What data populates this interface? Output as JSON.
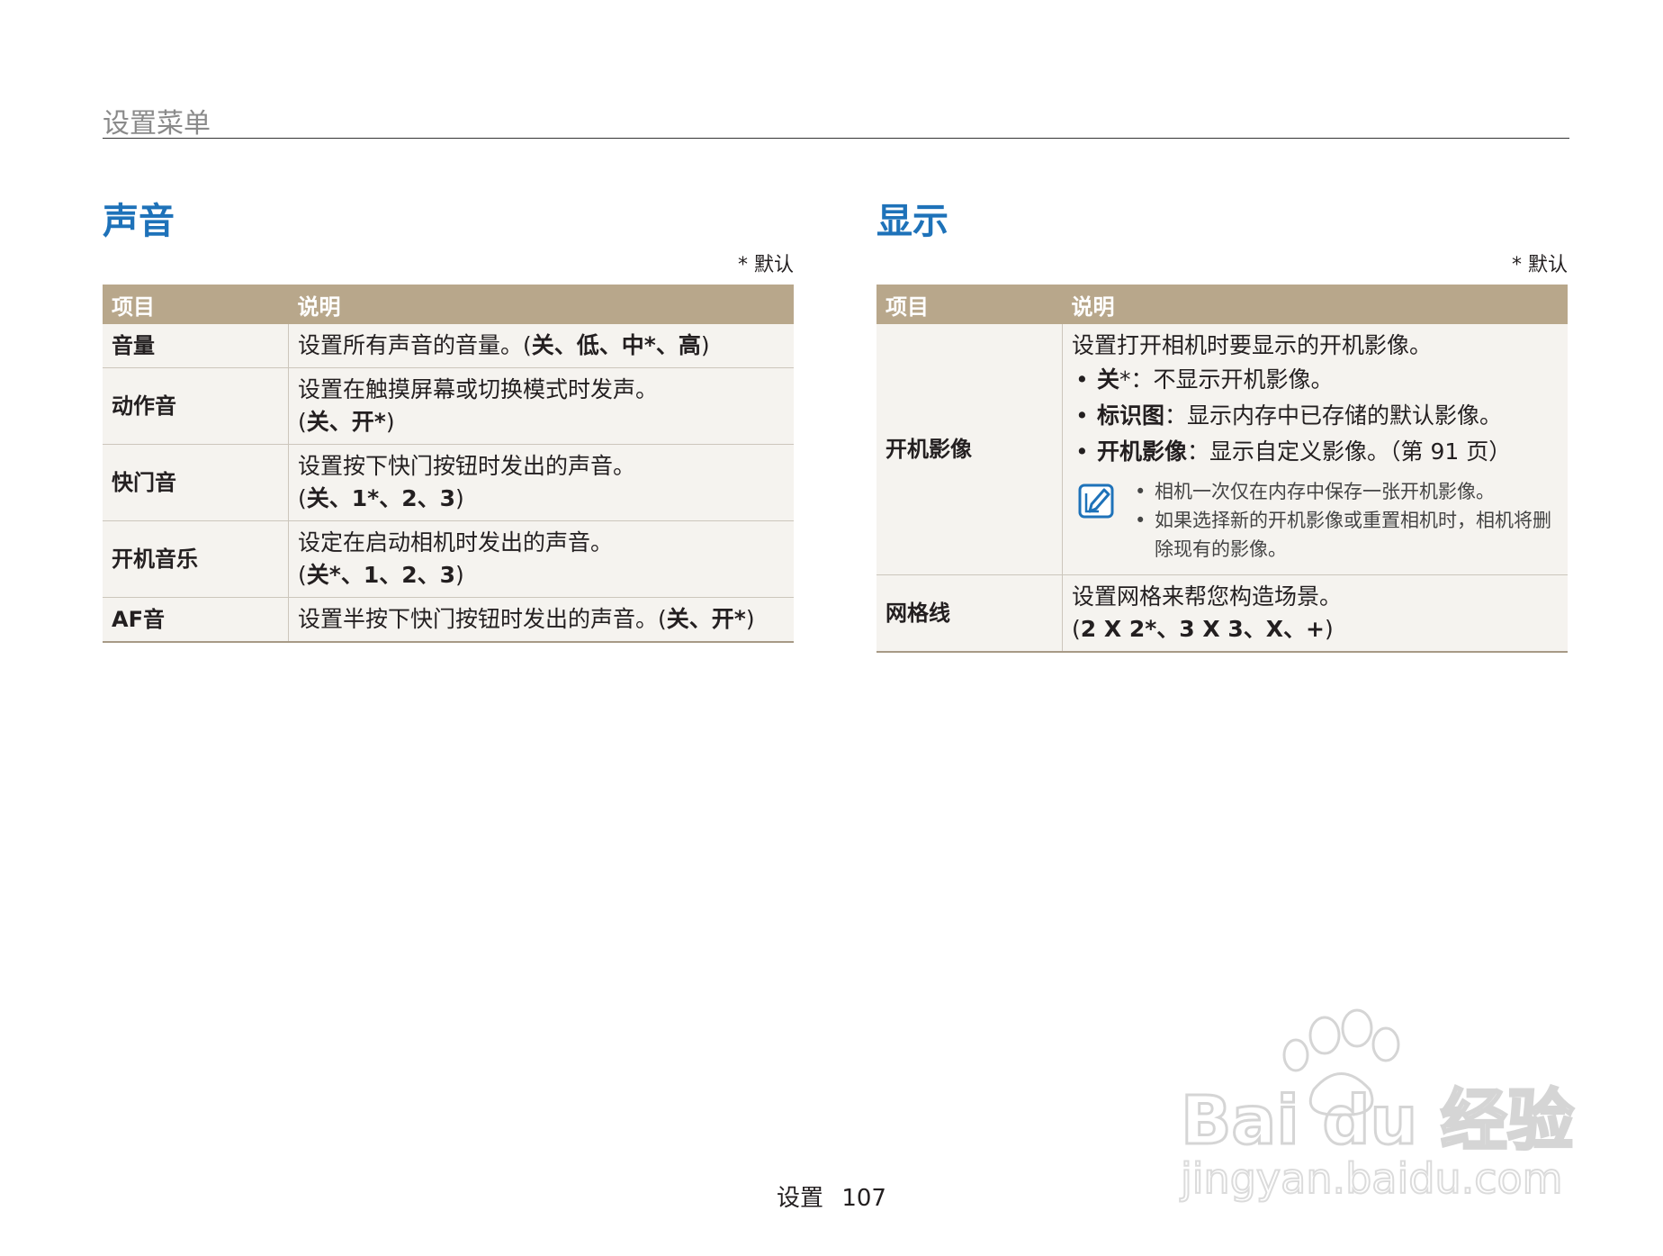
{
  "header": {
    "title": "设置菜单"
  },
  "sound": {
    "title": "声音",
    "default_note": "* 默认",
    "col_item": "项目",
    "col_desc": "说明",
    "rows": [
      {
        "item": "音量",
        "desc": "设置所有声音的音量。",
        "opts_open": "(",
        "opts_bold": "关、低、中*、高",
        "opts_close": ")"
      },
      {
        "item": "动作音",
        "desc": "设置在触摸屏幕或切换模式时发声。",
        "opts_open": "(",
        "opts_bold": "关、开*",
        "opts_close": ")"
      },
      {
        "item": "快门音",
        "desc": "设置按下快门按钮时发出的声音。",
        "opts_open": "(",
        "opts_bold": "关、1*、2、3",
        "opts_close": ")"
      },
      {
        "item": "开机音乐",
        "desc": "设定在启动相机时发出的声音。",
        "opts_open": "(",
        "opts_bold": "关*、1、2、3",
        "opts_close": ")"
      },
      {
        "item": "AF音",
        "desc": "设置半按下快门按钮时发出的声音。",
        "opts_open": "(",
        "opts_bold": "关、开*",
        "opts_close": ")"
      }
    ]
  },
  "display": {
    "title": "显示",
    "default_note": "* 默认",
    "col_item": "项目",
    "col_desc": "说明",
    "startup": {
      "item": "开机影像",
      "desc": "设置打开相机时要显示的开机影像。",
      "bullets": [
        {
          "bold": "关",
          "text": "*：不显示开机影像。"
        },
        {
          "bold": "标识图",
          "text": "：显示内存中已存储的默认影像。"
        },
        {
          "bold": "开机影像",
          "text": "：显示自定义影像。（第 91 页）"
        }
      ],
      "notes": [
        "相机一次仅在内存中保存一张开机影像。",
        "如果选择新的开机影像或重置相机时，相机将删除现有的影像。"
      ],
      "note_icon": "note-icon"
    },
    "grid": {
      "item": "网格线",
      "desc": "设置网格来帮您构造场景。",
      "opts_open": "(",
      "opts_bold": "2 X 2*、3 X 3、X、+",
      "opts_close": ")"
    }
  },
  "footer": {
    "section": "设置",
    "page": "107"
  },
  "watermark": {
    "brand": "Bai du 经验",
    "url": "jingyan.baidu.com"
  }
}
